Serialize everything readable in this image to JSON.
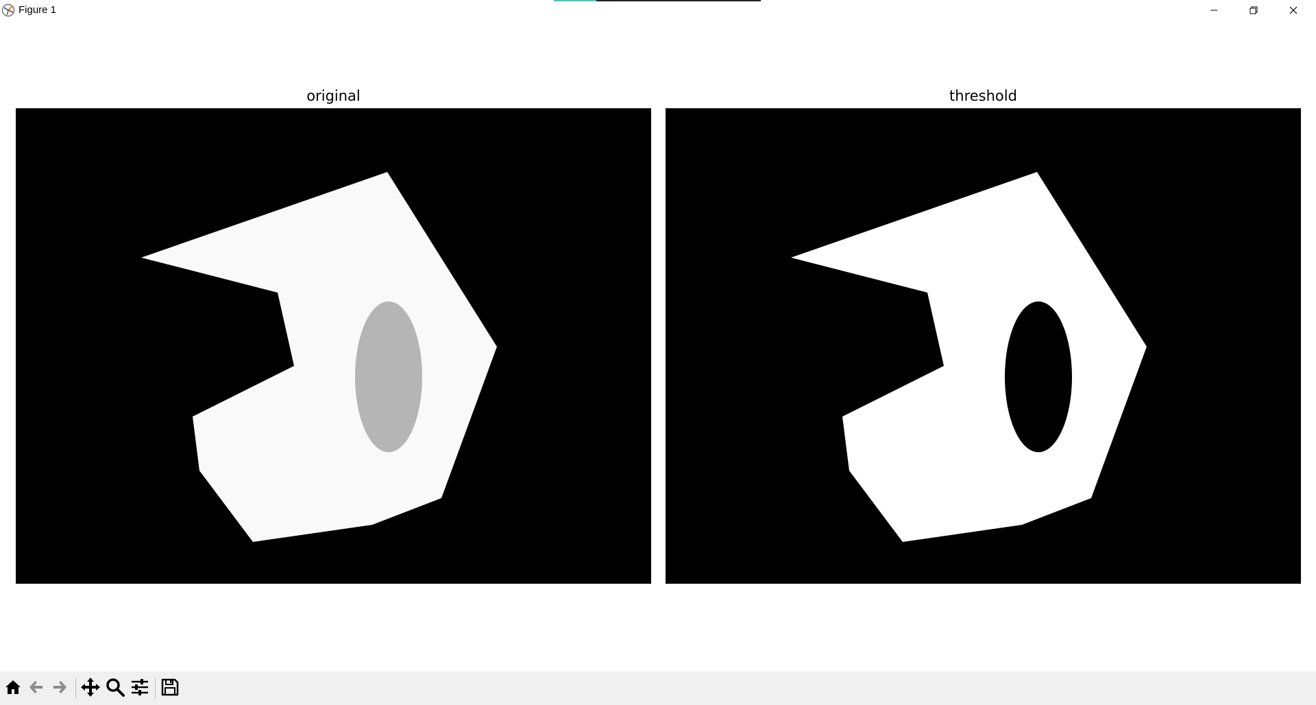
{
  "window": {
    "title": "Figure 1",
    "controls": {
      "minimize_icon": "minimize-icon",
      "maximize_icon": "restore-icon",
      "close_icon": "close-icon"
    }
  },
  "subplots": [
    {
      "title": "original",
      "background": "#000000",
      "shape_fill": "#f9f9f9",
      "ellipse_fill": "#b5b5b5"
    },
    {
      "title": "threshold",
      "background": "#000000",
      "shape_fill": "#ffffff",
      "ellipse_fill": "#000000"
    }
  ],
  "toolbar": {
    "buttons": [
      {
        "name": "home",
        "icon": "home-icon"
      },
      {
        "name": "back",
        "icon": "arrow-left-icon"
      },
      {
        "name": "forward",
        "icon": "arrow-right-icon"
      },
      {
        "name": "pan",
        "icon": "move-icon"
      },
      {
        "name": "zoom",
        "icon": "magnifier-icon"
      },
      {
        "name": "configure",
        "icon": "sliders-icon"
      },
      {
        "name": "save",
        "icon": "floppy-disk-icon"
      }
    ]
  }
}
